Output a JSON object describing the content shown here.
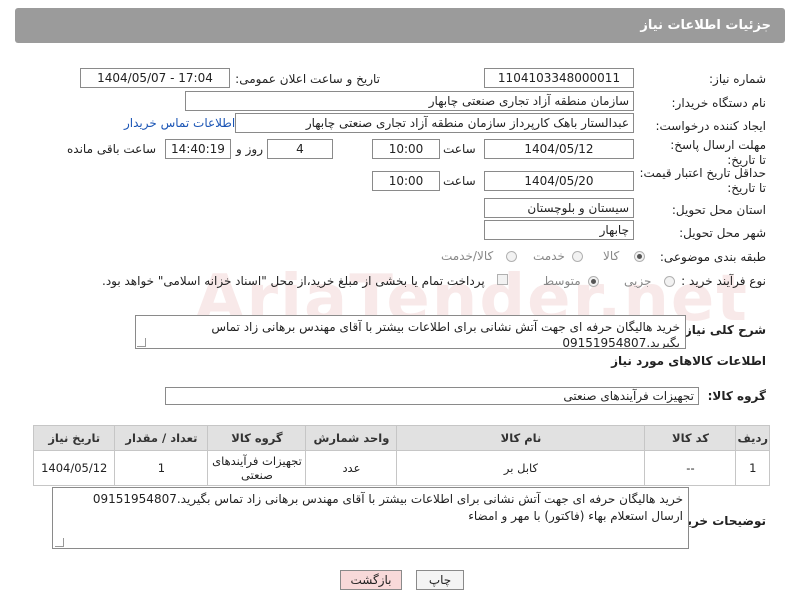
{
  "header": {
    "title": "جزئیات اطلاعات نیاز"
  },
  "fields": {
    "need_number_label": "شماره نیاز:",
    "need_number_value": "1104103348000011",
    "announce_label": "تاریخ و ساعت اعلان عمومی:",
    "announce_value": "1404/05/07 - 17:04",
    "buyer_org_label": "نام دستگاه خریدار:",
    "buyer_org_value": "سازمان منطقه آزاد تجاری صنعتی چابهار",
    "creator_label": "ایجاد کننده درخواست:",
    "creator_value": "عبدالستار باهک کارپرداز سازمان منطقه آزاد تجاری صنعتی چابهار",
    "buyer_contact_link": "اطلاعات تماس خریدار",
    "deadline_label": "مهلت ارسال پاسخ: تا تاریخ:",
    "deadline_date": "1404/05/12",
    "time_label": "ساعت",
    "deadline_time": "10:00",
    "days_value": "4",
    "days_label": "روز و",
    "remaining_time": "14:40:19",
    "remaining_label": "ساعت باقی مانده",
    "price_valid_label": "حداقل تاریخ اعتبار قیمت: تا تاریخ:",
    "price_valid_date": "1404/05/20",
    "price_valid_time": "10:00",
    "province_label": "استان محل تحویل:",
    "province_value": "سیستان و بلوچستان",
    "city_label": "شهر محل تحویل:",
    "city_value": "چابهار",
    "category_label": "طبقه بندی موضوعی:",
    "category_options": [
      "کالا",
      "خدمت",
      "کالا/خدمت"
    ],
    "process_label": "نوع فرآیند خرید :",
    "process_options": [
      "جزیی",
      "متوسط"
    ],
    "payment_note": "پرداخت تمام یا بخشی از مبلغ خرید،از محل \"اسناد خزانه اسلامی\" خواهد بود."
  },
  "description": {
    "label": "شرح کلی نیاز:",
    "text": "خرید هالیگان حرفه ای جهت آتش نشانی برای اطلاعات بیشتر با آقای مهندس برهانی زاد تماس بگیرید.09151954807"
  },
  "goods_section": {
    "title": "اطلاعات کالاهای مورد نیاز",
    "group_label": "گروه کالا:",
    "group_value": "تجهیزات فرآیندهای صنعتی"
  },
  "table": {
    "headers": [
      "ردیف",
      "کد کالا",
      "نام کالا",
      "واحد شمارش",
      "گروه کالا",
      "تعداد / مقدار",
      "تاریخ نیاز"
    ],
    "rows": [
      [
        "1",
        "--",
        "کابل بر",
        "عدد",
        "تجهیزات فرآیندهای صنعتی",
        "1",
        "1404/05/12"
      ]
    ]
  },
  "buyer_notes": {
    "label": "توضیحات خریدار:",
    "text": "خرید هالیگان حرفه ای جهت آتش نشانی برای اطلاعات بیشتر با آقای مهندس برهانی زاد تماس بگیرید.09151954807 ارسال استعلام بهاء (فاکتور) با مهر و امضاء"
  },
  "buttons": {
    "print": "چاپ",
    "back": "بازگشت"
  },
  "watermark": "AriaTender.net"
}
